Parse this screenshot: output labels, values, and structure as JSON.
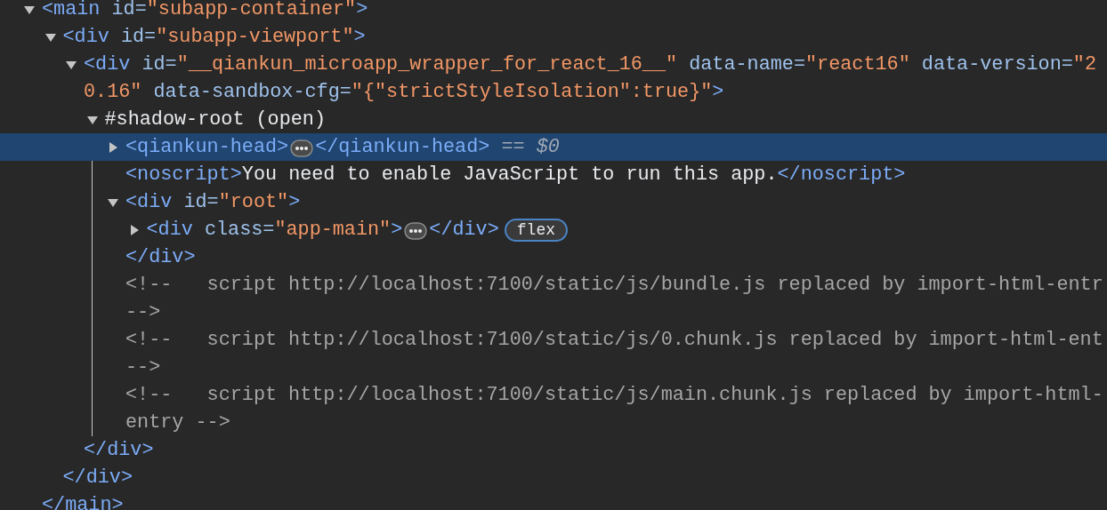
{
  "dom_tree": {
    "nodes": [
      {
        "expanded": true,
        "selected": false,
        "lines": [
          [
            {
              "kind": "tag",
              "text": "<main"
            },
            {
              "kind": "attr",
              "text": " id="
            },
            {
              "kind": "value",
              "text": "\"subapp-container\""
            },
            {
              "kind": "tag",
              "text": ">"
            }
          ]
        ],
        "close": [
          {
            "kind": "tag",
            "text": "</main>"
          }
        ],
        "children": [
          {
            "expanded": true,
            "selected": false,
            "lines": [
              [
                {
                  "kind": "tag",
                  "text": "<div"
                },
                {
                  "kind": "attr",
                  "text": " id="
                },
                {
                  "kind": "value",
                  "text": "\"subapp-viewport\""
                },
                {
                  "kind": "tag",
                  "text": ">"
                }
              ]
            ],
            "close": [
              {
                "kind": "tag",
                "text": "</div>"
              }
            ],
            "children": [
              {
                "expanded": true,
                "selected": false,
                "lines": [
                  [
                    {
                      "kind": "tag",
                      "text": "<div"
                    },
                    {
                      "kind": "attr",
                      "text": " id="
                    },
                    {
                      "kind": "value",
                      "text": "\"__qiankun_microapp_wrapper_for_react_16__\""
                    },
                    {
                      "kind": "attr",
                      "text": " data-name="
                    },
                    {
                      "kind": "value",
                      "text": "\"react16\""
                    },
                    {
                      "kind": "attr",
                      "text": " data-version="
                    },
                    {
                      "kind": "value",
                      "text": "\"2"
                    }
                  ],
                  [
                    {
                      "kind": "value",
                      "text": "0.16\""
                    },
                    {
                      "kind": "attr",
                      "text": " data-sandbox-cfg="
                    },
                    {
                      "kind": "value",
                      "text": "\"{\"strictStyleIsolation\":true}\""
                    },
                    {
                      "kind": "tag",
                      "text": ">"
                    }
                  ]
                ],
                "close": [
                  {
                    "kind": "tag",
                    "text": "</div>"
                  }
                ],
                "children": [
                  {
                    "expanded": true,
                    "selected": false,
                    "lines": [
                      [
                        {
                          "kind": "shadow",
                          "text": "#shadow-root (open)"
                        }
                      ]
                    ],
                    "children": [
                      {
                        "expanded": false,
                        "selected": true,
                        "lines": [
                          [
                            {
                              "kind": "tag",
                              "text": "<qiankun-head>"
                            },
                            {
                              "kind": "ellipsis"
                            },
                            {
                              "kind": "tag",
                              "text": "</qiankun-head>"
                            },
                            {
                              "kind": "ref",
                              "text": " == $0"
                            }
                          ]
                        ]
                      },
                      {
                        "selected": false,
                        "lines": [
                          [
                            {
                              "kind": "tag",
                              "text": "<noscript>"
                            },
                            {
                              "kind": "text",
                              "text": "You need to enable JavaScript to run this app."
                            },
                            {
                              "kind": "tag",
                              "text": "</noscript>"
                            }
                          ]
                        ]
                      },
                      {
                        "expanded": true,
                        "selected": false,
                        "lines": [
                          [
                            {
                              "kind": "tag",
                              "text": "<div"
                            },
                            {
                              "kind": "attr",
                              "text": " id="
                            },
                            {
                              "kind": "value",
                              "text": "\"root\""
                            },
                            {
                              "kind": "tag",
                              "text": ">"
                            }
                          ]
                        ],
                        "close": [
                          {
                            "kind": "tag",
                            "text": "</div>"
                          }
                        ],
                        "children": [
                          {
                            "expanded": false,
                            "selected": false,
                            "lines": [
                              [
                                {
                                  "kind": "tag",
                                  "text": "<div"
                                },
                                {
                                  "kind": "attr",
                                  "text": " class="
                                },
                                {
                                  "kind": "value",
                                  "text": "\"app-main\""
                                },
                                {
                                  "kind": "tag",
                                  "text": ">"
                                },
                                {
                                  "kind": "ellipsis"
                                },
                                {
                                  "kind": "tag",
                                  "text": "</div>"
                                },
                                {
                                  "kind": "badge",
                                  "text": "flex"
                                }
                              ]
                            ]
                          }
                        ]
                      },
                      {
                        "selected": false,
                        "lines": [
                          [
                            {
                              "kind": "comment",
                              "text": "<!--   script http://localhost:7100/static/js/bundle.js replaced by import-html-entr"
                            }
                          ],
                          [
                            {
                              "kind": "comment",
                              "text": "-->"
                            }
                          ]
                        ]
                      },
                      {
                        "selected": false,
                        "lines": [
                          [
                            {
                              "kind": "comment",
                              "text": "<!--   script http://localhost:7100/static/js/0.chunk.js replaced by import-html-ent"
                            }
                          ],
                          [
                            {
                              "kind": "comment",
                              "text": "-->"
                            }
                          ]
                        ]
                      },
                      {
                        "selected": false,
                        "lines": [
                          [
                            {
                              "kind": "comment",
                              "text": "<!--   script http://localhost:7100/static/js/main.chunk.js replaced by import-html-"
                            }
                          ],
                          [
                            {
                              "kind": "comment",
                              "text": "entry -->"
                            }
                          ]
                        ]
                      }
                    ]
                  }
                ]
              }
            ]
          }
        ]
      }
    ]
  }
}
